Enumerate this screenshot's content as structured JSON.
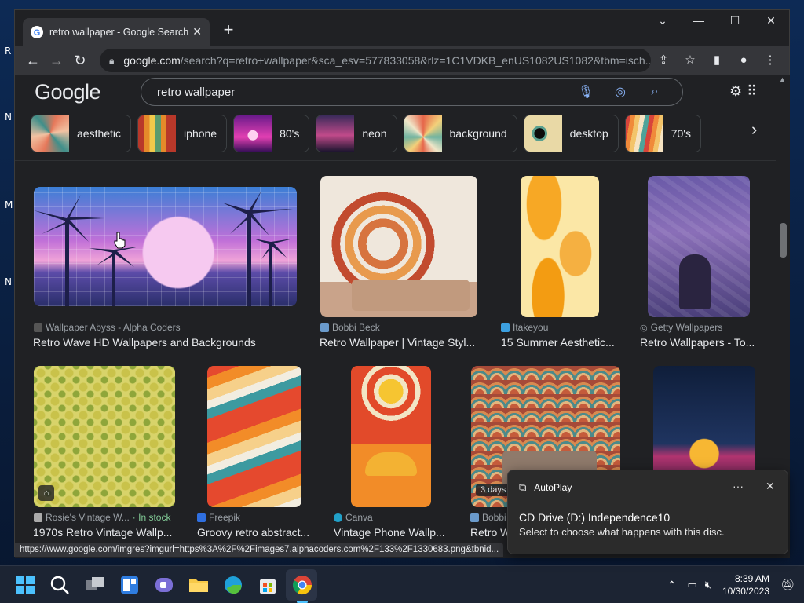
{
  "desktop": {
    "icon_labels": [
      "R",
      "N",
      "M",
      "N"
    ]
  },
  "browser": {
    "tab_title": "retro wallpaper - Google Search",
    "omnibox": {
      "domain": "google.com",
      "path": "/search?q=retro+wallpaper&sca_esv=577833058&rlz=1C1VDKB_enUS1082US1082&tbm=isch..."
    }
  },
  "google": {
    "logo": "Google",
    "query": "retro wallpaper",
    "chips": [
      {
        "label": "aesthetic"
      },
      {
        "label": "iphone"
      },
      {
        "label": "80's"
      },
      {
        "label": "neon"
      },
      {
        "label": "background"
      },
      {
        "label": "desktop"
      },
      {
        "label": "70's"
      }
    ],
    "results": [
      {
        "source": "Wallpaper Abyss - Alpha Coders",
        "title": "Retro Wave HD Wallpapers and Backgrounds"
      },
      {
        "source": "Bobbi Beck",
        "title": "Retro Wallpaper | Vintage Styl..."
      },
      {
        "source": "Itakeyou",
        "title": "15 Summer Aesthetic..."
      },
      {
        "source": "Getty Wallpapers",
        "title": "Retro Wallpapers - To..."
      },
      {
        "source": "Rosie's Vintage W...",
        "stock": " · In stock",
        "title": "1970s Retro Vintage Wallp..."
      },
      {
        "source": "Freepik",
        "title": "Groovy retro abstract..."
      },
      {
        "source": "Canva",
        "title": "Vintage Phone Wallp..."
      },
      {
        "source": "Bobbi",
        "title": "Retro W",
        "badge": "3 days"
      }
    ]
  },
  "status_url": "https://www.google.com/imgres?imgurl=https%3A%2F%2Fimages7.alphacoders.com%2F133%2F1330683.png&tbnid...",
  "toast": {
    "app": "AutoPlay",
    "title": "CD Drive (D:) Independence10",
    "message": "Select to choose what happens with this disc."
  },
  "taskbar": {
    "time": "8:39 AM",
    "date": "10/30/2023"
  }
}
